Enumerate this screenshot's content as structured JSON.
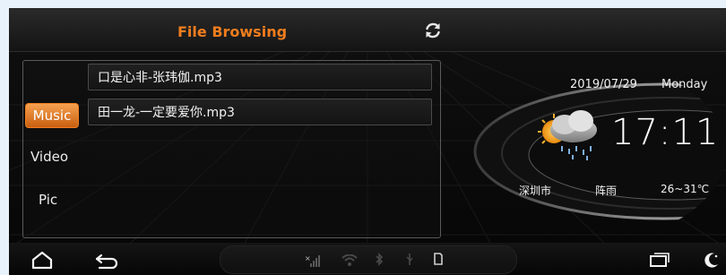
{
  "header": {
    "title": "File Browsing",
    "refresh_icon": "refresh-icon"
  },
  "categories": [
    {
      "label": "Music",
      "selected": true
    },
    {
      "label": "Video",
      "selected": false
    },
    {
      "label": "Pic",
      "selected": false
    }
  ],
  "files": [
    {
      "name": "口是心非-张玮伽.mp3"
    },
    {
      "name": "田一龙-一定要爱你.mp3"
    }
  ],
  "clock": {
    "date": "2019/07/29",
    "weekday": "Monday",
    "time": "17:11"
  },
  "weather": {
    "icon": "cloud-rain-sun-icon",
    "city": "深圳市",
    "condition": "阵雨",
    "temperature": "26~31℃"
  },
  "bottom_bar": {
    "home_icon": "home-icon",
    "back_icon": "back-icon",
    "status_icons": [
      "signal-icon",
      "wifi-icon",
      "bluetooth-icon",
      "usb-icon",
      "storage-icon"
    ],
    "recent_apps_icon": "recent-apps-icon",
    "night_mode_icon": "night-mode-icon"
  },
  "colors": {
    "accent": "#f07d1e",
    "background": "#0b0b0b"
  }
}
